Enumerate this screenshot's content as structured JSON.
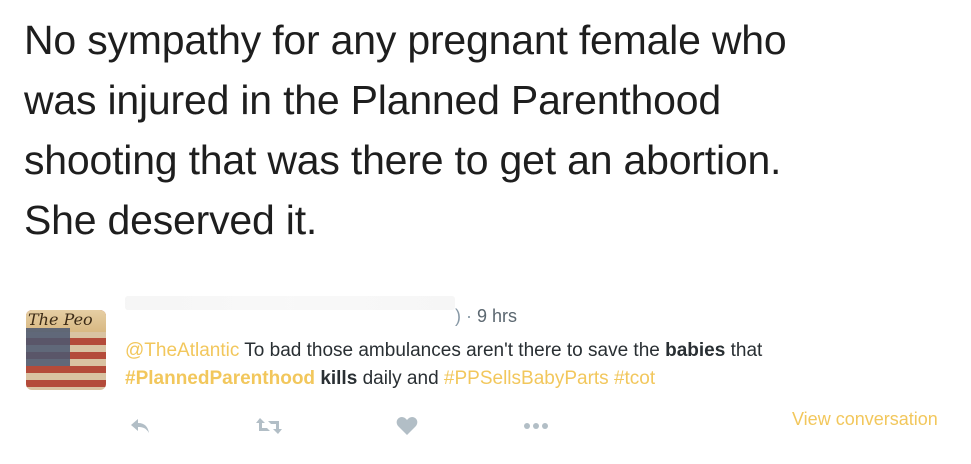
{
  "big_tweet": {
    "lines": [
      "No sympathy for any pregnant female who",
      "was injured in the Planned Parenthood",
      "shooting that was there to get an abortion.",
      "She deserved it."
    ]
  },
  "reply": {
    "avatar_text": "The Peo",
    "meta": {
      "separator": ") · ",
      "time": "9 hrs"
    },
    "text": {
      "mention": "@TheAtlantic",
      "part1": " To bad those ambulances aren't there to save the ",
      "bold1": "babies",
      "part2": " that",
      "hashtag1": "#PlannedParenthood",
      "part3": " ",
      "bold2": "kills",
      "part4": " daily and ",
      "hashtag2": "#PPSellsBabyParts",
      "part5": " ",
      "hashtag3": "#tcot"
    },
    "actions": {
      "reply_icon": "reply-icon",
      "retweet_icon": "retweet-icon",
      "like_icon": "heart-icon",
      "more_icon": "more-icon"
    },
    "view_conversation": "View conversation"
  },
  "colors": {
    "link": "#f2c75c",
    "icon": "#b2bec6",
    "meta": "#8899a6"
  }
}
